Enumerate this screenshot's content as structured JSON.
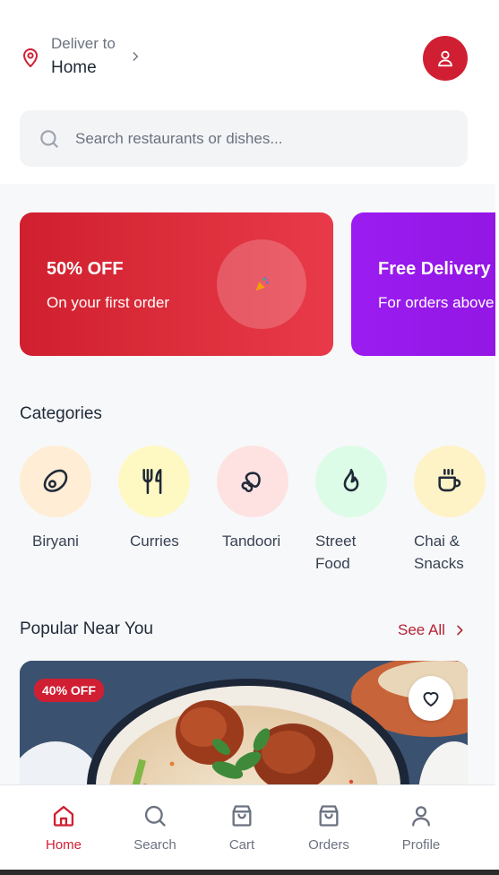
{
  "header": {
    "deliver_label": "Deliver to",
    "location": "Home"
  },
  "search": {
    "placeholder": "Search restaurants or dishes..."
  },
  "banners": [
    {
      "title": "50% OFF",
      "subtitle": "On your first order"
    },
    {
      "title": "Free Delivery",
      "subtitle": "For orders above"
    }
  ],
  "categories": {
    "title": "Categories",
    "items": [
      {
        "label": "Biryani",
        "color": "#ffedd5"
      },
      {
        "label": "Curries",
        "color": "#fef9c3"
      },
      {
        "label": "Tandoori",
        "color": "#fee2e2"
      },
      {
        "label": "Street Food",
        "color": "#dcfce7"
      },
      {
        "label": "Chai & Snacks",
        "color": "#fef3c7"
      }
    ]
  },
  "popular": {
    "title": "Popular Near You",
    "see_all": "See All",
    "card": {
      "badge": "40% OFF"
    }
  },
  "tabs": [
    {
      "label": "Home",
      "icon": "home-icon"
    },
    {
      "label": "Search",
      "icon": "search-icon"
    },
    {
      "label": "Cart",
      "icon": "bag-icon"
    },
    {
      "label": "Orders",
      "icon": "bag-icon"
    },
    {
      "label": "Profile",
      "icon": "user-icon"
    }
  ],
  "colors": {
    "brand": "#d01f33",
    "promo_purple": "#9b1cf0"
  }
}
